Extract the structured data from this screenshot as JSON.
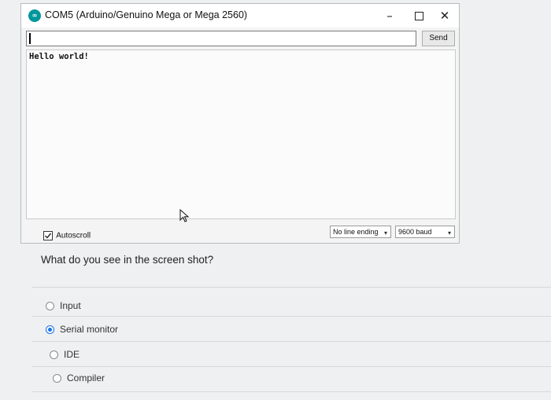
{
  "window": {
    "icon_text": "∞",
    "title": "COM5 (Arduino/Genuino Mega or Mega 2560)",
    "minimize_glyph": "–",
    "close_glyph": "✕"
  },
  "serial": {
    "input_value": "",
    "send_label": "Send",
    "output_text": "Hello world!",
    "autoscroll_label": "Autoscroll",
    "autoscroll_checked": true,
    "line_ending": "No line ending",
    "baud": "9600 baud"
  },
  "quiz": {
    "question": "What do you see in the screen shot?",
    "options": [
      {
        "label": "Input",
        "selected": false
      },
      {
        "label": "Serial monitor",
        "selected": true
      },
      {
        "label": "IDE",
        "selected": false
      },
      {
        "label": "Compiler",
        "selected": false
      }
    ]
  }
}
